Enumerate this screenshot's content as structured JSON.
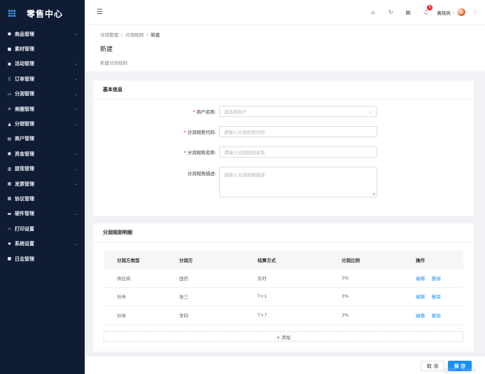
{
  "app": {
    "title": "零售中心"
  },
  "sidebar": {
    "items": [
      {
        "label": "商品管理",
        "icon": "tag-icon",
        "glyph": "●",
        "chevron": true
      },
      {
        "label": "素材管理",
        "icon": "file-icon",
        "glyph": "■",
        "chevron": false
      },
      {
        "label": "活动管理",
        "icon": "calendar-icon",
        "glyph": "▣",
        "chevron": true
      },
      {
        "label": "订单管理",
        "icon": "order-icon",
        "glyph": "▯",
        "chevron": true
      },
      {
        "label": "分润管理",
        "icon": "monitor-icon",
        "glyph": "▭",
        "chevron": true
      },
      {
        "label": "商圈管理",
        "icon": "list-icon",
        "glyph": "≡",
        "chevron": true
      },
      {
        "label": "分销管理",
        "icon": "home-icon",
        "glyph": "▲",
        "chevron": true
      },
      {
        "label": "商户管理",
        "icon": "shop-icon",
        "glyph": "▤",
        "chevron": false
      },
      {
        "label": "资金管理",
        "icon": "wallet-icon",
        "glyph": "▣",
        "chevron": true
      },
      {
        "label": "提现管理",
        "icon": "card-icon",
        "glyph": "▥",
        "chevron": true
      },
      {
        "label": "发票管理",
        "icon": "invoice-icon",
        "glyph": "▦",
        "chevron": true
      },
      {
        "label": "协议管理",
        "icon": "doc-icon",
        "glyph": "▩",
        "chevron": false
      },
      {
        "label": "硬件管理",
        "icon": "device-icon",
        "glyph": "▬",
        "chevron": true
      },
      {
        "label": "打印设置",
        "icon": "printer-icon",
        "glyph": "▱",
        "chevron": false
      },
      {
        "label": "系统设置",
        "icon": "gear-icon",
        "glyph": "✹",
        "chevron": true
      },
      {
        "label": "日志管理",
        "icon": "log-icon",
        "glyph": "■",
        "chevron": false
      }
    ]
  },
  "header": {
    "notification_count": "6",
    "user_name": "黄晓燕"
  },
  "breadcrumb": [
    "分润管理",
    "分润规则",
    "新建"
  ],
  "page": {
    "title": "新建",
    "subtitle": "新建分润规则"
  },
  "basic_info": {
    "title": "基本信息",
    "merchant": {
      "label": "商户名称:",
      "placeholder": "请选择商户",
      "required": true
    },
    "rule_code": {
      "label": "分润规则代码:",
      "placeholder": "请输入分润规则代码",
      "required": true
    },
    "rule_name": {
      "label": "分润规则名称:",
      "placeholder": "请输入分润规则名称",
      "required": true
    },
    "rule_desc": {
      "label": "分润规则描述:",
      "placeholder": "请输入分润规则描述",
      "required": false
    }
  },
  "detail": {
    "title": "分润规则明细",
    "columns": [
      "分润方类型",
      "分润方",
      "结算方式",
      "分润比例",
      "操作"
    ],
    "rows": [
      {
        "type": "供应商",
        "party": "国药",
        "settle": "实时",
        "ratio": "3%"
      },
      {
        "type": "伙伴",
        "party": "张三",
        "settle": "T+1",
        "ratio": "3%"
      },
      {
        "type": "伙伴",
        "party": "李四",
        "settle": "T+7",
        "ratio": "3%"
      }
    ],
    "edit_label": "编辑",
    "delete_label": "删除",
    "add_label": "+ 添加"
  },
  "footer": {
    "cancel_label": "取 消",
    "save_label": "保 存",
    "watermark": "@Pa...mind"
  }
}
